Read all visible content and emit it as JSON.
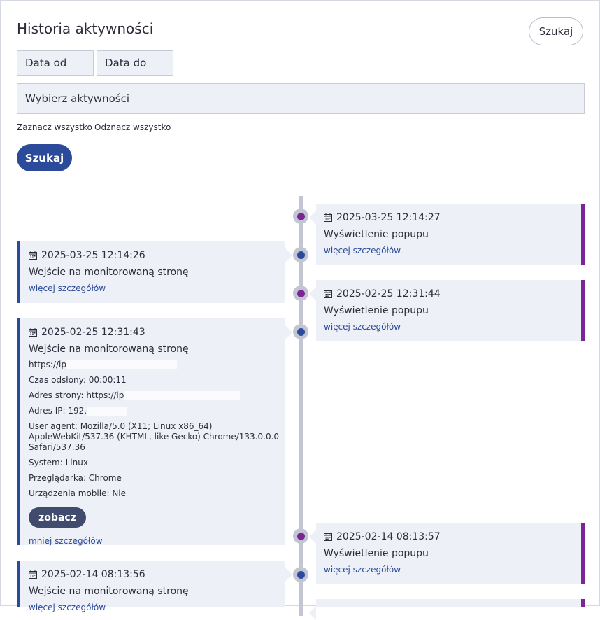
{
  "header": {
    "title": "Historia aktywności",
    "search_top_label": "Szukaj"
  },
  "filters": {
    "date_from_placeholder": "Data od",
    "date_to_placeholder": "Data do",
    "activities_placeholder": "Wybierz aktywności",
    "select_all": "Zaznacz wszystko",
    "deselect_all": "Odznacz wszystko",
    "search_label": "Szukaj"
  },
  "colors": {
    "accent_blue": "#2a4a9c",
    "accent_purple": "#7b2596",
    "primary_button": "#2b4a9a",
    "dark_button": "#414b6e"
  },
  "events": [
    {
      "date": "2025-03-25 12:14:27",
      "activity": "Wyświetlenie popupu",
      "link": "więcej szczegółów"
    },
    {
      "date": "2025-03-25 12:14:26",
      "activity": "Wejście na monitorowaną stronę",
      "link": "więcej szczegółów"
    },
    {
      "date": "2025-02-25 12:31:44",
      "activity": "Wyświetlenie popupu",
      "link": "więcej szczegółów"
    },
    {
      "date": "2025-02-25 12:31:43",
      "activity": "Wejście na monitorowaną stronę",
      "details": {
        "url": "https://ip",
        "time_on_page": "Czas odsłony: 00:00:11",
        "page_address": "Adres strony: https://ip",
        "ip_address": "Adres IP: 192.",
        "user_agent": "User agent: Mozilla/5.0 (X11; Linux x86_64) AppleWebKit/537.36 (KHTML, like Gecko) Chrome/133.0.0.0 Safari/537.36",
        "system": "System: Linux",
        "browser": "Przeglądarka: Chrome",
        "mobile": "Urządzenia mobile: Nie"
      },
      "view_button": "zobacz",
      "link": "mniej szczegółów"
    },
    {
      "date": "2025-02-14 08:13:57",
      "activity": "Wyświetlenie popupu",
      "link": "więcej szczegółów"
    },
    {
      "date": "2025-02-14 08:13:56",
      "activity": "Wejście na monitorowaną stronę",
      "link": "więcej szczegółów"
    }
  ]
}
